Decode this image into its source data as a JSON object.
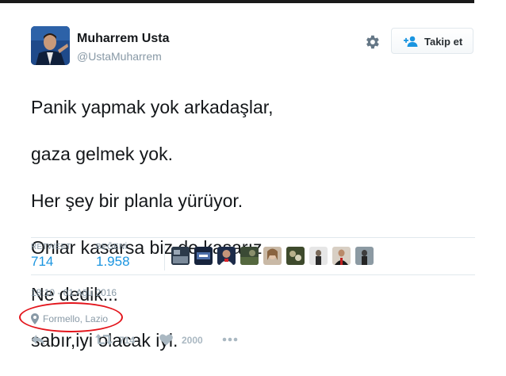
{
  "user": {
    "display_name": "Muharrem Usta",
    "handle": "@UstaMuharrem"
  },
  "header": {
    "follow_label": "Takip et"
  },
  "tweet": {
    "lines": [
      "Panik yapmak yok arkadaşlar,",
      "gaza gelmek yok.",
      "Her şey bir planla yürüyor.",
      "Onlar kasarsa biz de kasarız.",
      "Ne dedik...",
      "sabır,iyi olacak iyi."
    ]
  },
  "stats": {
    "retweet_label": "RETWEET",
    "retweet_count": "714",
    "like_label": "BEĞENİ",
    "like_count": "1.958"
  },
  "likers": [
    "liker-1",
    "liker-2",
    "liker-3",
    "liker-4",
    "liker-5",
    "liker-6",
    "liker-7",
    "liker-8",
    "liker-9"
  ],
  "meta": {
    "timestamp": "18:10 - 01 Ağu 2016",
    "location": "Formello, Lazio"
  },
  "actions": {
    "retweet_count": "714",
    "like_count": "2000"
  },
  "icons": {
    "settings": "gear-icon",
    "follow": "add-person-icon",
    "location": "map-pin-icon",
    "reply": "reply-icon",
    "retweet": "retweet-icon",
    "like": "heart-icon",
    "more": "more-dots-icon"
  },
  "colors": {
    "link_blue": "#1b95e0",
    "muted": "#8899a6",
    "annotation_red": "#e3141b"
  }
}
